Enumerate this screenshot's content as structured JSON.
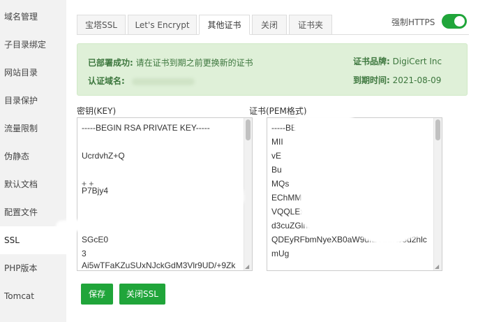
{
  "sidebar": {
    "items": [
      {
        "label": "域名管理"
      },
      {
        "label": "子目录绑定"
      },
      {
        "label": "网站目录"
      },
      {
        "label": "目录保护"
      },
      {
        "label": "流量限制"
      },
      {
        "label": "伪静态"
      },
      {
        "label": "默认文档"
      },
      {
        "label": "配置文件"
      },
      {
        "label": "SSL",
        "active": true
      },
      {
        "label": "PHP版本"
      },
      {
        "label": "Tomcat"
      }
    ]
  },
  "tabs": [
    {
      "label": "宝塔SSL"
    },
    {
      "label": "Let's Encrypt"
    },
    {
      "label": "其他证书",
      "active": true
    },
    {
      "label": "关闭"
    },
    {
      "label": "证书夹"
    }
  ],
  "https": {
    "label": "强制HTTPS",
    "enabled": true
  },
  "info": {
    "deployed_label": "已部署成功:",
    "deployed_text": "请在证书到期之前更换新的证书",
    "domain_label": "认证域名:",
    "brand_label": "证书品牌:",
    "brand_value": "DigiCert Inc",
    "expire_label": "到期时间:",
    "expire_value": "2021-08-09"
  },
  "key": {
    "label": "密钥(KEY)",
    "lines": [
      "-----BEGIN RSA PRIVATE KEY-----",
      "",
      "UcrdvhZ+Q",
      "",
      "P7Bjy4",
      "",
      "",
      "SGcE0",
      "3",
      "Ai5wTFaKZuSUxNJckGdM3Vlr9UD/+9Zk"
    ]
  },
  "cert": {
    "label": "证书(PEM格式)",
    "lines": [
      "-----BE",
      "MII",
      "vE",
      "Bu",
      "MQs",
      "EChMM",
      "VQQLEx",
      "d3cuZGlnaW",
      "QDEyRFbmNyeXB0aW9uIEV2ZXJ5d2hlc",
      "mUg"
    ]
  },
  "buttons": {
    "save": "保存",
    "close_ssl": "关闭SSL"
  },
  "colors": {
    "accent": "#20a53a",
    "info_bg": "#dff0d8",
    "info_text": "#3c763d"
  }
}
